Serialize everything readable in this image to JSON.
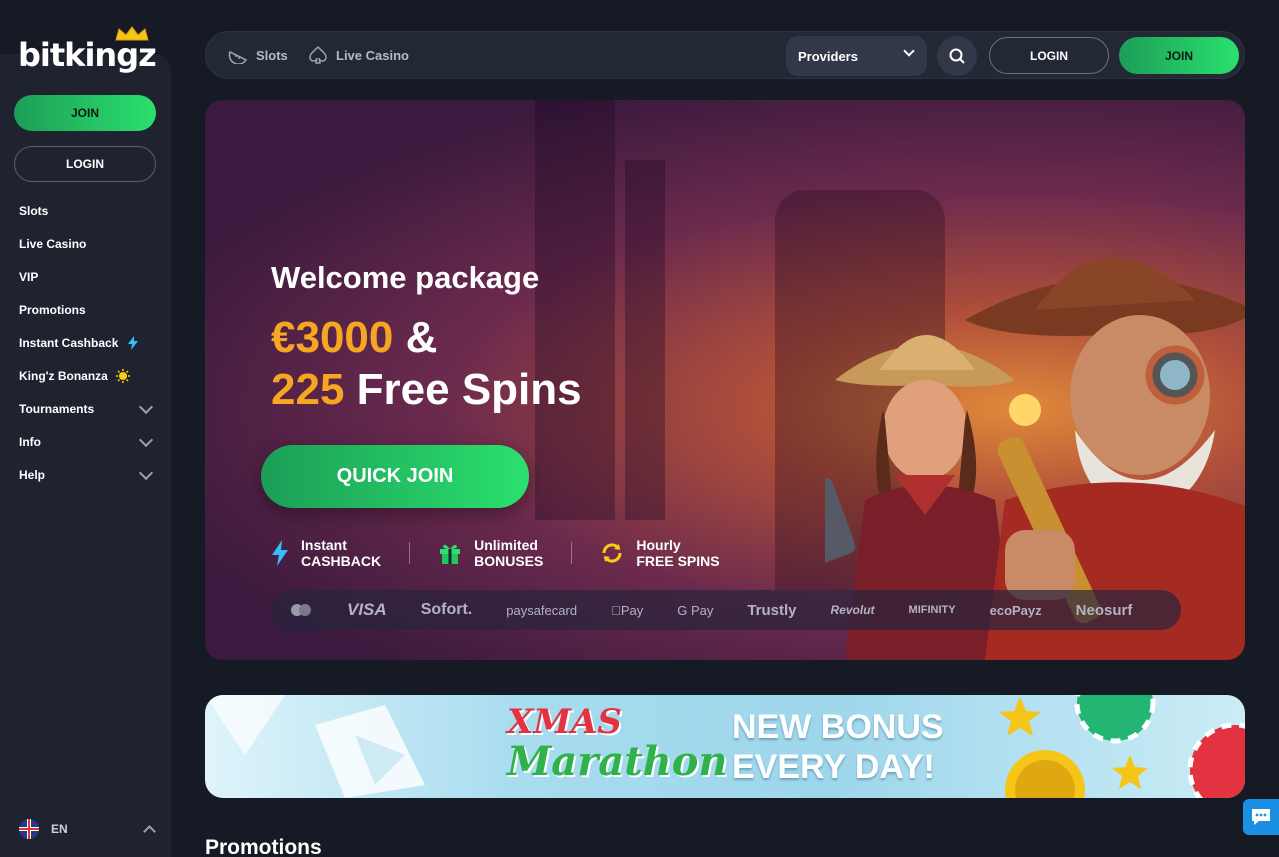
{
  "brand": {
    "name": "bitkingz"
  },
  "sidebar": {
    "join_label": "JOIN",
    "login_label": "LOGIN",
    "items": [
      {
        "label": "Slots"
      },
      {
        "label": "Live Casino"
      },
      {
        "label": "VIP"
      },
      {
        "label": "Promotions"
      },
      {
        "label": "Instant Cashback",
        "icon": "lightning-icon"
      },
      {
        "label": "King'z Bonanza",
        "icon": "sun-icon"
      },
      {
        "label": "Tournaments",
        "expandable": true
      },
      {
        "label": "Info",
        "expandable": true
      },
      {
        "label": "Help",
        "expandable": true
      }
    ],
    "language": "EN"
  },
  "topbar": {
    "slots_label": "Slots",
    "live_casino_label": "Live Casino",
    "providers_label": "Providers",
    "login_label": "LOGIN",
    "join_label": "JOIN"
  },
  "hero": {
    "headline": "Welcome package",
    "amount_gold": "€3000",
    "amount_rest": " &",
    "spins_gold": "225",
    "spins_rest": " Free Spins",
    "cta_label": "QUICK JOIN",
    "features": [
      {
        "line1": "Instant",
        "line2": "CASHBACK",
        "icon": "lightning-icon"
      },
      {
        "line1": "Unlimited",
        "line2": "BONUSES",
        "icon": "gift-icon"
      },
      {
        "line1": "Hourly",
        "line2": "FREE SPINS",
        "icon": "refresh-icon"
      }
    ],
    "payments": [
      "VISA",
      "Sofort.",
      "paysafecard",
      "Pay",
      "G Pay",
      "Trustly",
      "Revolut",
      "MIFINITY",
      "ecoPayz",
      "Neosurf"
    ]
  },
  "xmas_banner": {
    "title_line1": "XMAS",
    "title_line2": "Marathon",
    "tagline_line1": "NEW BONUS",
    "tagline_line2": "EVERY DAY!"
  },
  "promotions_title": "Promotions",
  "colors": {
    "accent_green": "#2be06e",
    "gold": "#f5a623",
    "background": "#161a24"
  }
}
